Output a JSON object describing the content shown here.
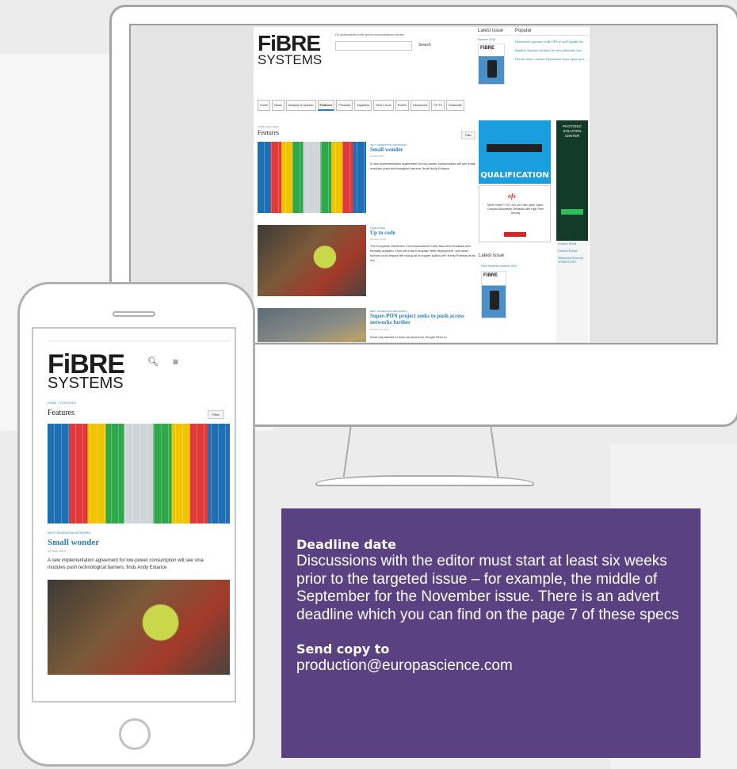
{
  "site": {
    "logo_line1": "FiBRE",
    "logo_line2": "SYSTEMS",
    "tagline": "For professionals in the optical communications industry",
    "search_button": "Search",
    "latest_issue_heading": "Latest issue",
    "latest_issue_label": "Summer 2019",
    "popular_heading": "Popular",
    "popular_items": [
      "Openreach partners with OFS to aid Gigabit ba...",
      "Sparkle chooses Infinera for new photonic bac...",
      "Ofcom rules confirm Openreach must open up it..."
    ],
    "nav": [
      "Home",
      "News",
      "Analysis & Opinion",
      "Features",
      "Products",
      "Suppliers",
      "Tech Focus",
      "Events",
      "Resources",
      "FS TV",
      "Subscribe"
    ],
    "breadcrumb": "HOME  /  FEATURES",
    "page_title": "Features",
    "filter_label": "Filter",
    "articles": [
      {
        "category": "NEXT GENERATION NETWORKS",
        "title": "Small wonder",
        "date": "23 May 2019",
        "text": "A new implementation agreement for low-power consumption will see small modules push technological barriers, finds Andy Extance"
      },
      {
        "category": "TELECOMMS",
        "title": "Up to code",
        "date": "02 March 2019",
        "text": "The European Electronic Communications Code has been finalised and formally adopted. How will it aid European fibre deployment, and what factors could impact the end goal of copper switch-off? Keely Portway finds out"
      },
      {
        "category": "NEXT GENERATION NETWORKS",
        "title": "Super-PON project seeks to push access networks further",
        "date": "02 February 2019",
        "text": "Work has started to hone an idea from Google Fiber to"
      }
    ],
    "ad_qualification": "QUALIFICATION",
    "ad_ofs_logo": "ofs",
    "ad_ofs_text": "NEW Fortex™ DIT 200 µm Fiber Optic Cable. Compact Bandwidth Demands with High Fiber Density",
    "ad_green_text": "PHOTONIC SOLUTION CENTER",
    "events_heading": "Events",
    "events": [
      "Connect World",
      "Connect Europe",
      "Submarine Networks WORLD 2019"
    ],
    "latest_issue_heading2": "Latest issue",
    "latest_issue_label2": "Fibre Systems Summer 2019"
  },
  "phone": {
    "breadcrumb": "HOME  /  FEATURES",
    "page_title": "Features",
    "filter_label": "Filter",
    "category": "NEXT GENERATION NETWORKS",
    "title": "Small wonder",
    "date": "23 May 2019",
    "text_line1": "A new implementation agreement for low-power consumption will see sma",
    "text_line2": "modules push technological barriers, finds Andy Extance"
  },
  "info": {
    "deadline_heading": "Deadline date",
    "deadline_text": "Discussions with the editor must start at least six weeks prior to the targeted issue – for example, the middle of September for the November issue. There is an advert deadline which you can find on the page 7 of these specs",
    "send_heading": "Send copy to",
    "send_email": "production@europascience.com"
  },
  "colors": {
    "accent_blue": "#2a7fb8",
    "info_purple": "#5a4282",
    "device_outline": "#a5a5a5"
  }
}
